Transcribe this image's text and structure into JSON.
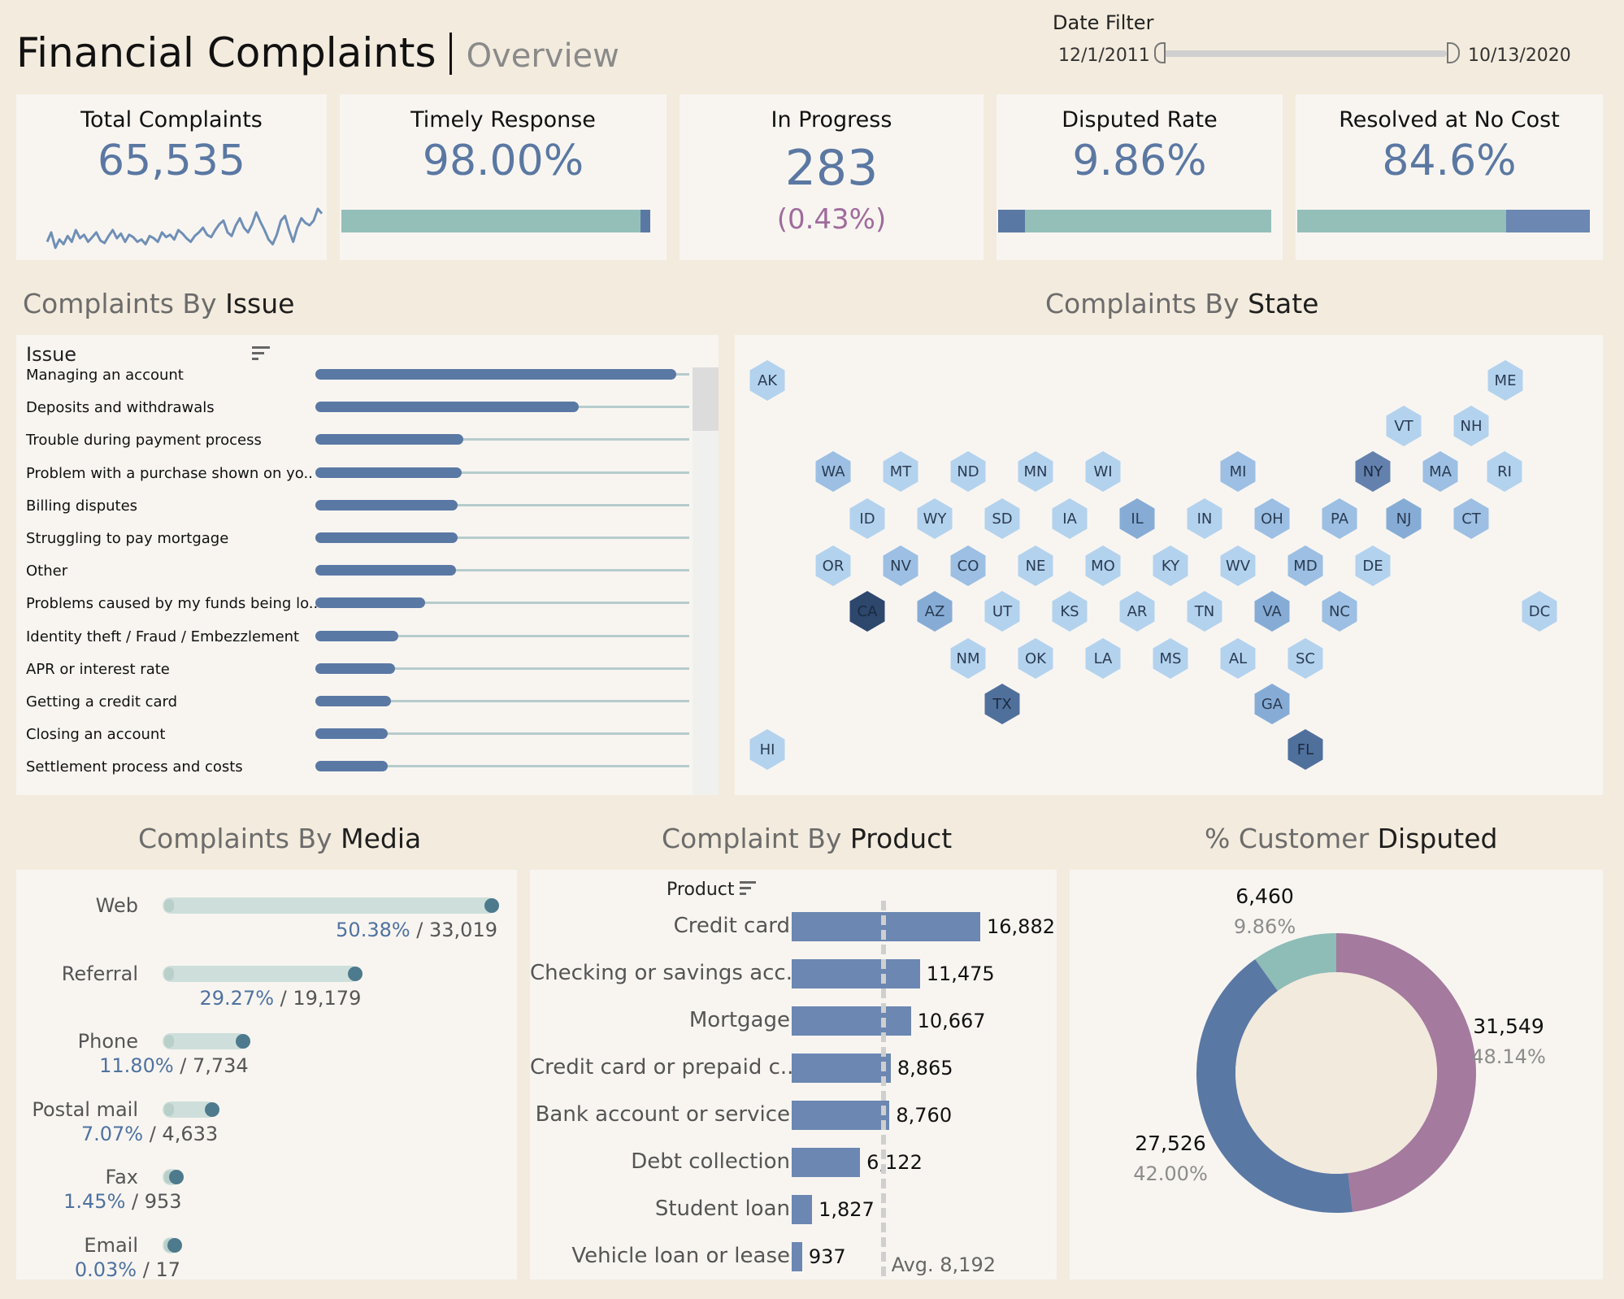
{
  "header": {
    "title": "Financial Complaints",
    "subtitle": "Overview"
  },
  "date_filter": {
    "label": "Date Filter",
    "start": "12/1/2011",
    "end": "10/13/2020"
  },
  "kpis": {
    "total": {
      "label": "Total  Complaints",
      "value": "65,535"
    },
    "timely": {
      "label": "Timely Response",
      "value": "98.00%",
      "fraction": 0.98
    },
    "in_progress": {
      "label": "In Progress",
      "value": "283",
      "sub": "(0.43%)"
    },
    "disputed": {
      "label": "Disputed Rate",
      "value": "9.86%",
      "fraction": 0.0986
    },
    "resolved": {
      "label": "Resolved at No Cost",
      "value": "84.6%",
      "fraction": 0.846
    }
  },
  "sections": {
    "issue": {
      "prefix": "Complaints By ",
      "bold": "Issue"
    },
    "state": {
      "prefix": "Complaints By ",
      "bold": "State"
    },
    "media": {
      "prefix": "Complaints By ",
      "bold": "Media"
    },
    "product": {
      "prefix": "Complaint By ",
      "bold": "Product"
    },
    "disputed": {
      "prefix": "% Customer ",
      "bold": "Disputed"
    }
  },
  "icons": {
    "sort": "sort-icon"
  },
  "colors": {
    "accent": "#5a78a2",
    "teal": "#94bfb9",
    "purple": "#a47a9e",
    "bg": "#f3ebdd",
    "panel": "#f8f5f1"
  },
  "chart_data": [
    {
      "type": "line",
      "name": "total-complaints-sparkline",
      "values": [
        30,
        38,
        25,
        32,
        28,
        35,
        30,
        40,
        33,
        36,
        30,
        34,
        38,
        31,
        29,
        35,
        40,
        33,
        37,
        30,
        36,
        34,
        30,
        32,
        28,
        35,
        33,
        30,
        38,
        34,
        36,
        32,
        40,
        37,
        33,
        30,
        35,
        38,
        42,
        36,
        34,
        40,
        45,
        48,
        38,
        35,
        44,
        50,
        42,
        38,
        45,
        55,
        47,
        40,
        32,
        28,
        36,
        48,
        52,
        40,
        30,
        42,
        50,
        46,
        44,
        48,
        58,
        54
      ]
    },
    {
      "type": "bar",
      "name": "complaints-by-issue",
      "header": "Issue",
      "categories": [
        "Managing an account",
        "Deposits and withdrawals",
        "Trouble during payment process",
        "Problem with a purchase shown on yo..",
        "Billing disputes",
        "Struggling to pay mortgage",
        "Other",
        "Problems caused by my funds being lo..",
        "Identity theft / Fraud / Embezzlement",
        "APR or interest rate",
        "Getting a credit card",
        "Closing an account",
        "Settlement process and costs"
      ],
      "values": [
        1.0,
        0.73,
        0.41,
        0.405,
        0.395,
        0.395,
        0.39,
        0.305,
        0.23,
        0.22,
        0.21,
        0.2,
        0.2
      ]
    },
    {
      "type": "heatmap",
      "name": "complaints-by-state",
      "states": [
        {
          "code": "AK",
          "level": 1
        },
        {
          "code": "ME",
          "level": 1
        },
        {
          "code": "VT",
          "level": 1
        },
        {
          "code": "NH",
          "level": 1
        },
        {
          "code": "WA",
          "level": 2
        },
        {
          "code": "MT",
          "level": 1
        },
        {
          "code": "ND",
          "level": 1
        },
        {
          "code": "MN",
          "level": 1
        },
        {
          "code": "WI",
          "level": 1
        },
        {
          "code": "MI",
          "level": 2
        },
        {
          "code": "NY",
          "level": 5
        },
        {
          "code": "MA",
          "level": 2
        },
        {
          "code": "RI",
          "level": 1
        },
        {
          "code": "ID",
          "level": 1
        },
        {
          "code": "WY",
          "level": 1
        },
        {
          "code": "SD",
          "level": 1
        },
        {
          "code": "IA",
          "level": 1
        },
        {
          "code": "IL",
          "level": 3
        },
        {
          "code": "IN",
          "level": 1
        },
        {
          "code": "OH",
          "level": 2
        },
        {
          "code": "PA",
          "level": 2
        },
        {
          "code": "NJ",
          "level": 3
        },
        {
          "code": "CT",
          "level": 2
        },
        {
          "code": "OR",
          "level": 1
        },
        {
          "code": "NV",
          "level": 2
        },
        {
          "code": "CO",
          "level": 2
        },
        {
          "code": "NE",
          "level": 1
        },
        {
          "code": "MO",
          "level": 1
        },
        {
          "code": "KY",
          "level": 1
        },
        {
          "code": "WV",
          "level": 1
        },
        {
          "code": "MD",
          "level": 2
        },
        {
          "code": "DE",
          "level": 1
        },
        {
          "code": "CA",
          "level": 8
        },
        {
          "code": "AZ",
          "level": 3
        },
        {
          "code": "UT",
          "level": 1
        },
        {
          "code": "KS",
          "level": 1
        },
        {
          "code": "AR",
          "level": 1
        },
        {
          "code": "TN",
          "level": 1
        },
        {
          "code": "VA",
          "level": 3
        },
        {
          "code": "NC",
          "level": 2
        },
        {
          "code": "DC",
          "level": 1
        },
        {
          "code": "NM",
          "level": 1
        },
        {
          "code": "OK",
          "level": 1
        },
        {
          "code": "LA",
          "level": 1
        },
        {
          "code": "MS",
          "level": 1
        },
        {
          "code": "AL",
          "level": 1
        },
        {
          "code": "SC",
          "level": 1
        },
        {
          "code": "TX",
          "level": 6
        },
        {
          "code": "GA",
          "level": 3
        },
        {
          "code": "HI",
          "level": 1
        },
        {
          "code": "FL",
          "level": 6
        }
      ]
    },
    {
      "type": "bar",
      "name": "complaints-by-media",
      "categories": [
        "Web",
        "Referral",
        "Phone",
        "Postal mail",
        "Fax",
        "Email"
      ],
      "values": [
        33019,
        19179,
        7734,
        4633,
        953,
        17
      ],
      "pct_labels": [
        "50.38%",
        "29.27%",
        "11.80%",
        "7.07%",
        "1.45%",
        "0.03%"
      ],
      "count_labels": [
        "33,019",
        "19,179",
        "7,734",
        "4,633",
        "953",
        "17"
      ]
    },
    {
      "type": "bar",
      "name": "complaint-by-product",
      "header": "Product",
      "categories": [
        "Credit card",
        "Checking or savings acc..",
        "Mortgage",
        "Credit card or prepaid c..",
        "Bank account or service",
        "Debt collection",
        "Student loan",
        "Vehicle loan or lease"
      ],
      "values": [
        16882,
        11475,
        10667,
        8865,
        8760,
        6122,
        1827,
        937
      ],
      "value_labels": [
        "16,882",
        "11,475",
        "10,667",
        "8,865",
        "8,760",
        "6,122",
        "1,827",
        "937"
      ],
      "reference_line": {
        "value": 8192,
        "label": "Avg. 8,192"
      }
    },
    {
      "type": "pie",
      "name": "customer-disputed",
      "values": [
        31549,
        27526,
        6460
      ],
      "value_labels": [
        "31,549",
        "27,526",
        "6,460"
      ],
      "pct_labels": [
        "48.14%",
        "42.00%",
        "9.86%"
      ],
      "colors": [
        "#a47a9e",
        "#5a78a4",
        "#8ebcb6"
      ]
    }
  ]
}
